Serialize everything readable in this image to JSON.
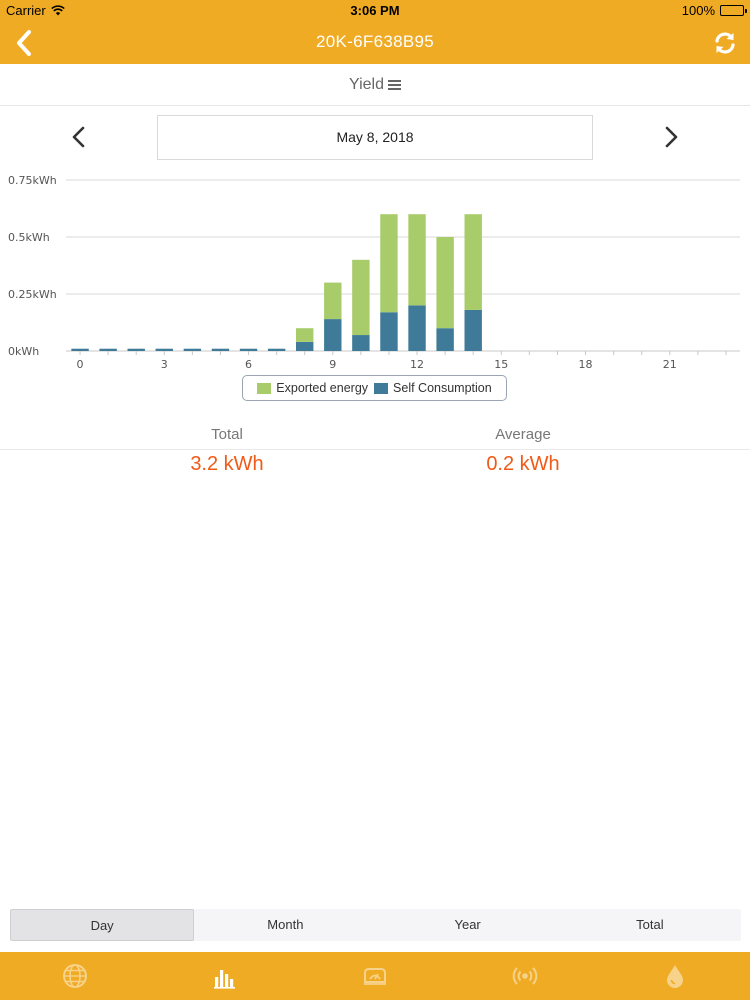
{
  "status_bar": {
    "carrier": "Carrier",
    "time": "3:06 PM",
    "battery": "100%"
  },
  "nav": {
    "title": "20K-6F638B95",
    "back_icon": "chevron-left-icon",
    "refresh_icon": "refresh-icon"
  },
  "subheader": {
    "label": "Yield"
  },
  "date_nav": {
    "date": "May 8, 2018"
  },
  "chart_data": {
    "type": "bar",
    "stacked": true,
    "x": [
      0,
      1,
      2,
      3,
      4,
      5,
      6,
      7,
      8,
      9,
      10,
      11,
      12,
      13,
      14,
      15,
      16,
      17,
      18,
      19,
      20,
      21,
      22,
      23
    ],
    "series": [
      {
        "name": "Self Consumption",
        "color": "#3f7b98",
        "values": [
          0.01,
          0.01,
          0.01,
          0.01,
          0.01,
          0.01,
          0.01,
          0.01,
          0.04,
          0.14,
          0.07,
          0.17,
          0.2,
          0.1,
          0.18,
          0,
          0,
          0,
          0,
          0,
          0,
          0,
          0,
          0
        ]
      },
      {
        "name": "Exported energy",
        "color": "#a9cc6a",
        "values": [
          0,
          0,
          0,
          0,
          0,
          0,
          0,
          0,
          0.06,
          0.16,
          0.33,
          0.43,
          0.4,
          0.4,
          0.42,
          0,
          0,
          0,
          0,
          0,
          0,
          0,
          0,
          0
        ]
      }
    ],
    "y_ticks": [
      "0kWh",
      "0.25kWh",
      "0.5kWh",
      "0.75kWh"
    ],
    "x_tick_labels": [
      "0",
      "3",
      "6",
      "9",
      "12",
      "15",
      "18",
      "21"
    ],
    "ylim": [
      0,
      0.75
    ],
    "grid": true,
    "legend": "bottom"
  },
  "summary": {
    "total_label": "Total",
    "total_value": "3.2 kWh",
    "average_label": "Average",
    "average_value": "0.2 kWh"
  },
  "segments": {
    "day": "Day",
    "month": "Month",
    "year": "Year",
    "total": "Total"
  },
  "tabbar": {
    "icons": [
      "globe-icon",
      "bar-chart-icon",
      "inverter-icon",
      "signal-icon",
      "drop-icon"
    ]
  },
  "colors": {
    "accent": "#f0ab24",
    "value": "#f05a16"
  }
}
